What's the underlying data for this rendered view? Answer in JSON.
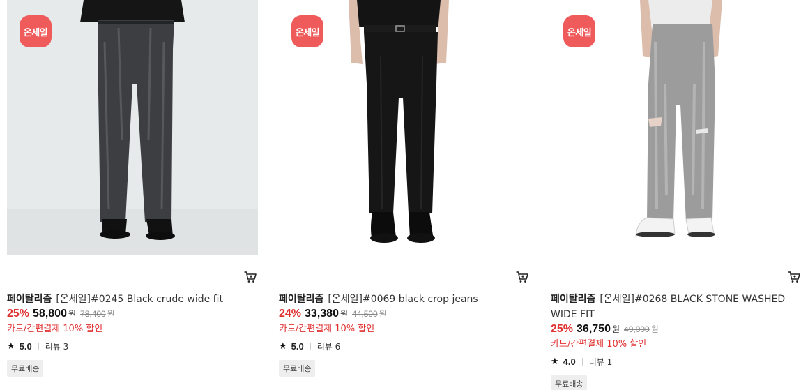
{
  "colors": {
    "badge": "#ef5b5b",
    "discount": "#e03131"
  },
  "products": [
    {
      "badge": "온세일",
      "brand": "페이탈리즘",
      "name": "[온세일]#0245 Black crude wide fit",
      "discount": "25%",
      "price": "58,800",
      "currency": "원",
      "original_price": "78,400",
      "card_discount": "카드/간편결제 10% 할인",
      "rating": "5.0",
      "reviews": "리뷰 3",
      "shipping": "무료배송",
      "image": "black-crude-wide-fit-jeans"
    },
    {
      "badge": "온세일",
      "brand": "페이탈리즘",
      "name": "[온세일]#0069 black crop jeans",
      "discount": "24%",
      "price": "33,380",
      "currency": "원",
      "original_price": "44,500",
      "card_discount": "카드/간편결제 10% 할인",
      "rating": "5.0",
      "reviews": "리뷰 6",
      "shipping": "무료배송",
      "image": "black-crop-jeans"
    },
    {
      "badge": "온세일",
      "brand": "페이탈리즘",
      "name": "[온세일]#0268 BLACK STONE WASHED WIDE FIT",
      "discount": "25%",
      "price": "36,750",
      "currency": "원",
      "original_price": "49,000",
      "card_discount": "카드/간편결제 10% 할인",
      "rating": "4.0",
      "reviews": "리뷰 1",
      "shipping": "무료배송",
      "image": "black-stone-washed-wide-fit-jeans"
    }
  ]
}
